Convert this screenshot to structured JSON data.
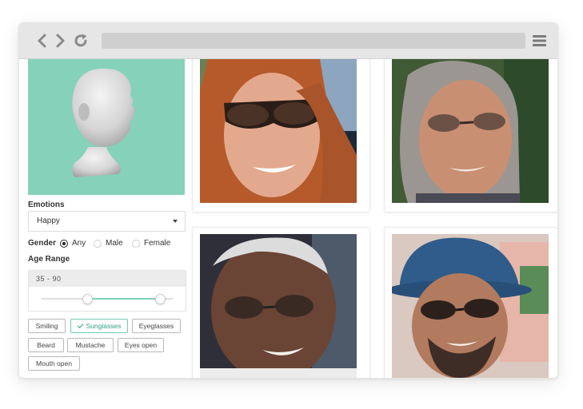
{
  "browser": {
    "back_icon": "chevron-left-icon",
    "forward_icon": "chevron-right-icon",
    "reload_icon": "reload-icon",
    "menu_icon": "hamburger-menu-icon",
    "address": ""
  },
  "sidebar": {
    "emotions_label": "Emotions",
    "emotion_selected": "Happy",
    "gender_label": "Gender",
    "gender_options": [
      "Any",
      "Male",
      "Female"
    ],
    "gender_selected": "Any",
    "age_label": "Age Range",
    "age_range_text": "35 - 90",
    "age_min": 35,
    "age_max": 90,
    "tags": [
      {
        "label": "Smiling",
        "active": false
      },
      {
        "label": "Sunglasses",
        "active": true
      },
      {
        "label": "Eyeglasses",
        "active": false
      },
      {
        "label": "Beard",
        "active": false
      },
      {
        "label": "Mustache",
        "active": false
      },
      {
        "label": "Eyes open",
        "active": false
      },
      {
        "label": "Mouth open",
        "active": false
      }
    ]
  },
  "colors": {
    "accent": "#7fd0bc",
    "head_panel_bg": "#86d1b9",
    "chip_active": "#2f9f86"
  }
}
